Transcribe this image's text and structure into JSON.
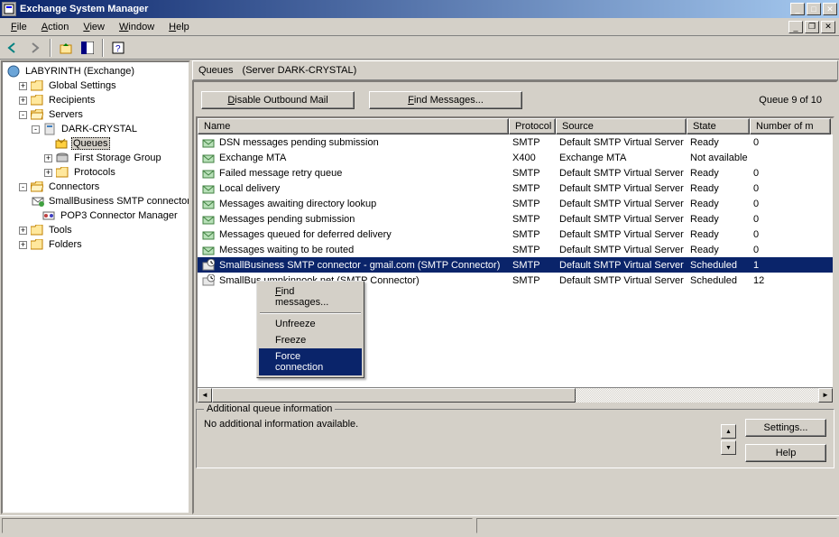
{
  "window": {
    "title": "Exchange System Manager"
  },
  "menubar": {
    "file": "File",
    "action": "Action",
    "view": "View",
    "window": "Window",
    "help": "Help"
  },
  "tree": {
    "root": "LABYRINTH (Exchange)",
    "global_settings": "Global Settings",
    "recipients": "Recipients",
    "servers": "Servers",
    "server_name": "DARK-CRYSTAL",
    "queues": "Queues",
    "first_storage_group": "First Storage Group",
    "protocols": "Protocols",
    "connectors": "Connectors",
    "smb_smtp_connector": "SmallBusiness SMTP connector",
    "pop3_connector_manager": "POP3 Connector Manager",
    "tools": "Tools",
    "folders": "Folders"
  },
  "content": {
    "header_label": "Queues",
    "header_context": "(Server DARK-CRYSTAL)",
    "disable_outbound": "Disable Outbound Mail",
    "find_messages": "Find Messages...",
    "queue_count": "Queue 9 of 10"
  },
  "columns": {
    "name": "Name",
    "protocol": "Protocol",
    "source": "Source",
    "state": "State",
    "number": "Number of m"
  },
  "rows": [
    {
      "name": "DSN messages pending submission",
      "protocol": "SMTP",
      "source": "Default SMTP Virtual Server",
      "state": "Ready",
      "number": "0",
      "icon": "queue-ready"
    },
    {
      "name": "Exchange MTA",
      "protocol": "X400",
      "source": "Exchange MTA",
      "state": "Not available",
      "number": "",
      "icon": "queue-ready"
    },
    {
      "name": "Failed message retry queue",
      "protocol": "SMTP",
      "source": "Default SMTP Virtual Server",
      "state": "Ready",
      "number": "0",
      "icon": "queue-ready"
    },
    {
      "name": "Local delivery",
      "protocol": "SMTP",
      "source": "Default SMTP Virtual Server",
      "state": "Ready",
      "number": "0",
      "icon": "queue-ready"
    },
    {
      "name": "Messages awaiting directory lookup",
      "protocol": "SMTP",
      "source": "Default SMTP Virtual Server",
      "state": "Ready",
      "number": "0",
      "icon": "queue-ready"
    },
    {
      "name": "Messages pending submission",
      "protocol": "SMTP",
      "source": "Default SMTP Virtual Server",
      "state": "Ready",
      "number": "0",
      "icon": "queue-ready"
    },
    {
      "name": "Messages queued for deferred delivery",
      "protocol": "SMTP",
      "source": "Default SMTP Virtual Server",
      "state": "Ready",
      "number": "0",
      "icon": "queue-ready"
    },
    {
      "name": "Messages waiting to be routed",
      "protocol": "SMTP",
      "source": "Default SMTP Virtual Server",
      "state": "Ready",
      "number": "0",
      "icon": "queue-ready"
    },
    {
      "name": "SmallBusiness SMTP connector - gmail.com (SMTP Connector)",
      "protocol": "SMTP",
      "source": "Default SMTP Virtual Server",
      "state": "Scheduled",
      "number": "1",
      "icon": "queue-scheduled",
      "selected": true
    },
    {
      "name": "SmallBus                                           umpkinnook.net (SMTP Connector)",
      "protocol": "SMTP",
      "source": "Default SMTP Virtual Server",
      "state": "Scheduled",
      "number": "12",
      "icon": "queue-scheduled"
    }
  ],
  "context_menu": {
    "find_messages": "Find messages...",
    "unfreeze": "Unfreeze",
    "freeze": "Freeze",
    "force_connection": "Force connection"
  },
  "additional_info": {
    "group_label": "Additional queue information",
    "text": "No additional information available.",
    "settings_btn": "Settings...",
    "help_btn": "Help"
  }
}
